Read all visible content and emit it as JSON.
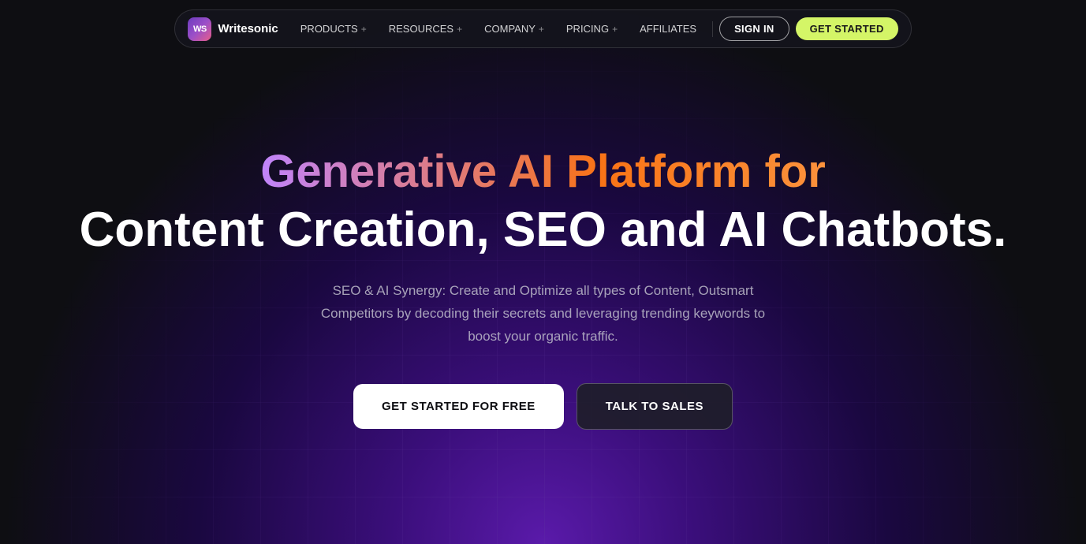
{
  "brand": {
    "logo_text": "WS",
    "name": "Writesonic"
  },
  "nav": {
    "items": [
      {
        "label": "PRODUCTS",
        "has_plus": true
      },
      {
        "label": "RESOURCES",
        "has_plus": true
      },
      {
        "label": "COMPANY",
        "has_plus": true
      },
      {
        "label": "PRICING",
        "has_plus": true
      },
      {
        "label": "AFFILIATES",
        "has_plus": false
      }
    ],
    "signin_label": "SIGN IN",
    "getstarted_label": "GET STARTED"
  },
  "hero": {
    "title_line1": "Generative AI Platform for",
    "title_line2": "Content Creation, SEO and AI Chatbots.",
    "subtitle": "SEO & AI Synergy: Create and Optimize all types of Content, Outsmart Competitors by decoding their secrets and leveraging trending keywords to boost your organic traffic.",
    "btn_primary": "GET STARTED FOR FREE",
    "btn_secondary": "TALK TO SALES"
  }
}
